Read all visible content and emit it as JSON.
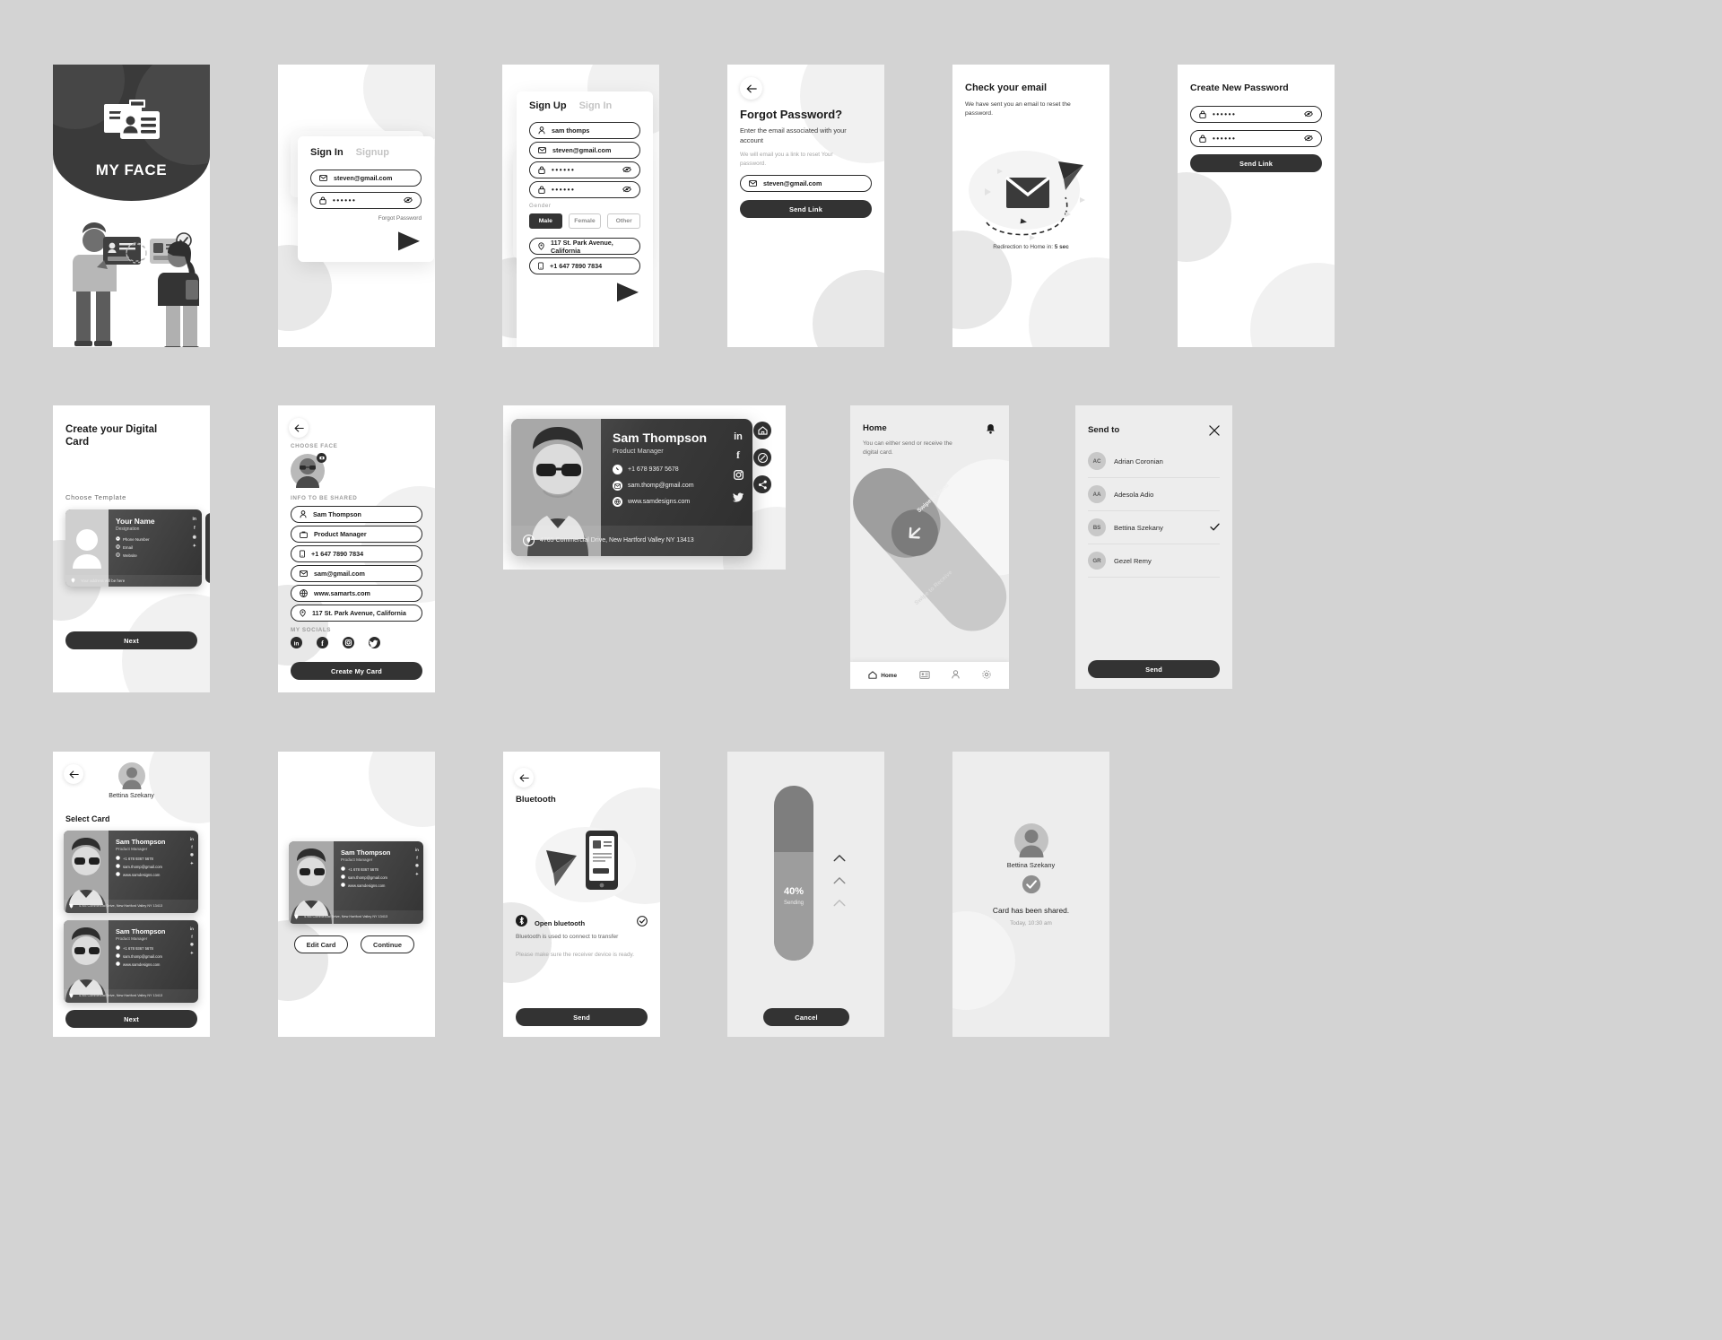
{
  "meta": {
    "bg": "#d3d3d3",
    "dark": "#333333",
    "accent": "#2b2b2b"
  },
  "screens": {
    "splash": {
      "app_name": "MY FACE"
    },
    "signin": {
      "tab_active": "Sign In",
      "tab_inactive": "Signup",
      "email": "steven@gmail.com",
      "password": "••••••",
      "forgot": "Forgot Password"
    },
    "signup": {
      "tab_active": "Sign Up",
      "tab_inactive": "Sign In",
      "name": "sam thomps",
      "email": "steven@gmail.com",
      "password": "••••••",
      "confirm_password": "••••••",
      "gender_label": "Gender",
      "gender_options": [
        "Male",
        "Female",
        "Other"
      ],
      "gender_selected": "Male",
      "address": "117 St. Park Avenue, California",
      "phone": "+1 647 7890 7834"
    },
    "forgot": {
      "title": "Forgot Password?",
      "subtitle": "Enter the email associated with your account",
      "note": "We will email you a link to reset Your password.",
      "email": "steven@gmail.com",
      "button": "Send Link"
    },
    "check_email": {
      "title": "Check your email",
      "subtitle": "We have sent you an email to reset the password.",
      "redirect_prefix": "Redirection to Home in:",
      "redirect_value": "5 sec"
    },
    "new_password": {
      "title": "Create New Password",
      "password": "••••••",
      "confirm_password": "••••••",
      "button": "Send Link"
    },
    "create_card": {
      "title": "Create your Digital Card",
      "choose_template": "Choose Template",
      "template_name": "Your Name",
      "template_role": "Designation",
      "template_phone": "Phone Number",
      "template_email": "Email",
      "template_website": "Website",
      "template_address": "Your address will be here",
      "next": "Next"
    },
    "choose_face": {
      "choose_face_label": "CHOOSE FACE",
      "info_label": "INFO TO BE SHARED",
      "fields": [
        "Sam Thompson",
        "Product Manager",
        "+1 647 7890 7834",
        "sam@gmail.com",
        "www.samarts.com",
        "117 St. Park Avenue, California"
      ],
      "socials_label": "MY SOCIALS",
      "socials": [
        "linkedin",
        "facebook",
        "instagram",
        "twitter"
      ],
      "button": "Create My Card"
    },
    "card_detail": {
      "name": "Sam Thompson",
      "role": "Product Manager",
      "phone": "+1 678 9367 5678",
      "email": "sam.thomp@gmail.com",
      "website": "www.samdesigns.com",
      "address": "4765 Commercial Drive, New Hartford Valley NY 13413",
      "socials": [
        "linkedin",
        "facebook",
        "instagram",
        "twitter"
      ],
      "actions": [
        "home-icon",
        "edit-icon",
        "share-icon"
      ]
    },
    "home": {
      "title": "Home",
      "subtitle": "You can either send or receive the digital card.",
      "swipe_send": "Swipe to Send",
      "swipe_receive": "Swipe to Receive",
      "tabs": [
        "Home",
        "Cards",
        "Profile",
        "Settings"
      ],
      "tab_active": "Home"
    },
    "send_to": {
      "title": "Send to",
      "contacts": [
        {
          "initials": "AC",
          "name": "Adrian Coronian",
          "selected": false
        },
        {
          "initials": "AA",
          "name": "Adesola Adio",
          "selected": false
        },
        {
          "initials": "BS",
          "name": "Bettina Szekany",
          "selected": true
        },
        {
          "initials": "GR",
          "name": "Gezel Remy",
          "selected": false
        }
      ],
      "button": "Send"
    },
    "select_card": {
      "user": "Bettina Szekany",
      "heading": "Select Card",
      "cards": [
        {
          "name": "Sam Thompson",
          "role": "Product Manager",
          "phone": "+1 678 9367 5678",
          "email": "sam.thomp@gmail.com",
          "website": "www.samdesigns.com",
          "address": "4765 Commercial Drive, New Hartford Valley NY 13413"
        },
        {
          "name": "Sam Thompson",
          "role": "Product Manager",
          "phone": "+1 678 9367 5678",
          "email": "sam.thomp@gmail.com",
          "website": "www.samdesigns.com",
          "address": "4765 Commercial Drive, New Hartford Valley NY 13413"
        }
      ],
      "next": "Next"
    },
    "preview_card": {
      "name": "Sam Thompson",
      "role": "Product Manager",
      "phone": "+1 678 9367 5678",
      "email": "sam.thomp@gmail.com",
      "website": "www.samdesigns.com",
      "address": "4765 Commercial Drive, New Hartford Valley NY 13413",
      "edit": "Edit Card",
      "continue": "Continue"
    },
    "bluetooth": {
      "title": "Bluetooth",
      "toggle_label": "Open bluetooth",
      "note": "Bluetooth is used to connect to transfer",
      "hint": "Please make sure the receiver device is ready.",
      "button": "Send"
    },
    "sending": {
      "percent": "40%",
      "status": "Sending",
      "cancel": "Cancel"
    },
    "shared": {
      "user": "Bettina Szekany",
      "message": "Card has been shared.",
      "time": "Today, 10:30 am"
    }
  }
}
